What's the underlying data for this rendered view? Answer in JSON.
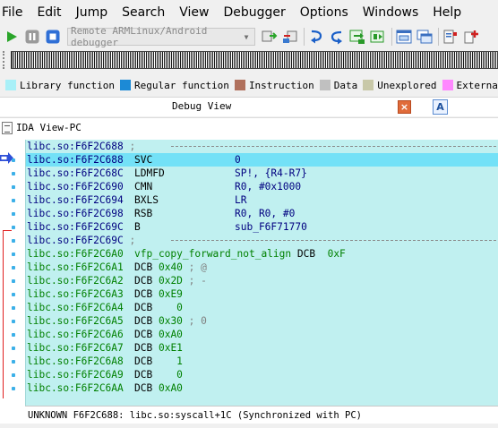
{
  "menu": [
    "File",
    "Edit",
    "Jump",
    "Search",
    "View",
    "Debugger",
    "Options",
    "Windows",
    "Help"
  ],
  "toolbar": {
    "debugger_select": "Remote ARMLinux/Android debugger"
  },
  "legend": [
    {
      "label": "Library function",
      "color": "#a8f0f8"
    },
    {
      "label": "Regular function",
      "color": "#1c8ad6"
    },
    {
      "label": "Instruction",
      "color": "#b0705c"
    },
    {
      "label": "Data",
      "color": "#c0c0c0"
    },
    {
      "label": "Unexplored",
      "color": "#c8c8a8"
    },
    {
      "label": "External sym",
      "color": "#ff88ff"
    }
  ],
  "debug_view": {
    "title": "Debug View",
    "close_label": "×",
    "a_label": "A"
  },
  "ida_view": {
    "title": "IDA View-PC"
  },
  "listing": [
    {
      "addr": "libc.so:F6F2C688",
      "kind": "sep",
      "text": " ; "
    },
    {
      "addr": "libc.so:F6F2C688",
      "kind": "code",
      "mn": "SVC",
      "op": "0",
      "pc": true
    },
    {
      "addr": "libc.so:F6F2C68C",
      "kind": "code",
      "mn": "LDMFD",
      "op": "SP!, {R4-R7}"
    },
    {
      "addr": "libc.so:F6F2C690",
      "kind": "code",
      "mn": "CMN",
      "op": "R0, #0x1000"
    },
    {
      "addr": "libc.so:F6F2C694",
      "kind": "code",
      "mn": "BXLS",
      "op": "LR"
    },
    {
      "addr": "libc.so:F6F2C698",
      "kind": "code",
      "mn": "RSB",
      "op": "R0, R0, #0"
    },
    {
      "addr": "libc.so:F6F2C69C",
      "kind": "code",
      "mn": "B",
      "op": "sub_F6F71770"
    },
    {
      "addr": "libc.so:F6F2C69C",
      "kind": "sep",
      "text": " ; "
    },
    {
      "addr": "libc.so:F6F2C6A0",
      "kind": "name",
      "name": "vfp_copy_forward_not_align",
      "mn": "DCB",
      "op": "0xF"
    },
    {
      "addr": "libc.so:F6F2C6A1",
      "kind": "data",
      "mn": "DCB",
      "op": "0x40",
      "cmt": " ; @"
    },
    {
      "addr": "libc.so:F6F2C6A2",
      "kind": "data",
      "mn": "DCB",
      "op": "0x2D",
      "cmt": " ; -"
    },
    {
      "addr": "libc.so:F6F2C6A3",
      "kind": "data",
      "mn": "DCB",
      "op": "0xE9",
      "cmt": ""
    },
    {
      "addr": "libc.so:F6F2C6A4",
      "kind": "data",
      "mn": "DCB",
      "op": "   0",
      "cmt": ""
    },
    {
      "addr": "libc.so:F6F2C6A5",
      "kind": "data",
      "mn": "DCB",
      "op": "0x30",
      "cmt": " ; 0"
    },
    {
      "addr": "libc.so:F6F2C6A6",
      "kind": "data",
      "mn": "DCB",
      "op": "0xA0",
      "cmt": ""
    },
    {
      "addr": "libc.so:F6F2C6A7",
      "kind": "data",
      "mn": "DCB",
      "op": "0xE1",
      "cmt": ""
    },
    {
      "addr": "libc.so:F6F2C6A8",
      "kind": "data",
      "mn": "DCB",
      "op": "   1",
      "cmt": ""
    },
    {
      "addr": "libc.so:F6F2C6A9",
      "kind": "data",
      "mn": "DCB",
      "op": "   0",
      "cmt": ""
    },
    {
      "addr": "libc.so:F6F2C6AA",
      "kind": "data",
      "mn": "DCB",
      "op": "0xA0",
      "cmt": ""
    }
  ],
  "status": "UNKNOWN F6F2C688: libc.so:syscall+1C (Synchronized with PC)"
}
